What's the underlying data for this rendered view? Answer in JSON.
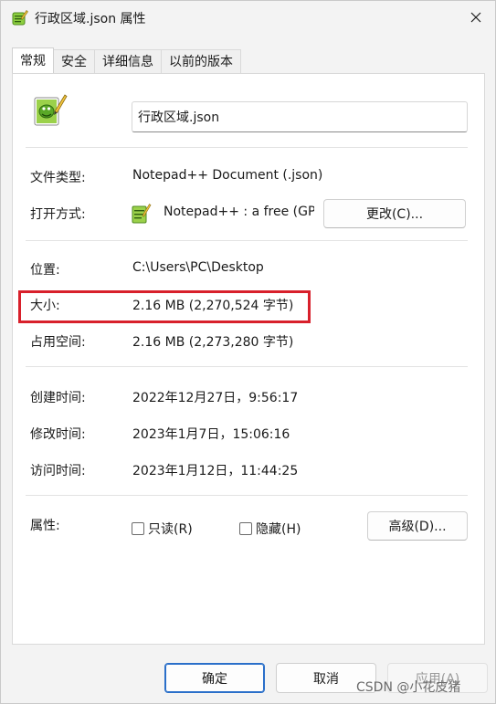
{
  "window": {
    "title": "行政区域.json 属性",
    "icon": "notepadpp-icon"
  },
  "tabs": [
    {
      "label": "常规",
      "active": true
    },
    {
      "label": "安全",
      "active": false
    },
    {
      "label": "详细信息",
      "active": false
    },
    {
      "label": "以前的版本",
      "active": false
    }
  ],
  "general": {
    "filename": "行政区域.json",
    "file_type_label": "文件类型:",
    "file_type_value": "Notepad++ Document (.json)",
    "open_with_label": "打开方式:",
    "open_with_value": "Notepad++ : a free (GPL) source code editor",
    "change_button": "更改(C)...",
    "location_label": "位置:",
    "location_value": "C:\\Users\\PC\\Desktop",
    "size_label": "大小:",
    "size_value": "2.16 MB (2,270,524 字节)",
    "size_on_disk_label": "占用空间:",
    "size_on_disk_value": "2.16 MB (2,273,280 字节)",
    "created_label": "创建时间:",
    "created_value": "2022年12月27日，9:56:17",
    "modified_label": "修改时间:",
    "modified_value": "2023年1月7日，15:06:16",
    "accessed_label": "访问时间:",
    "accessed_value": "2023年1月12日，11:44:25",
    "attributes_label": "属性:",
    "readonly_label": "只读(R)",
    "readonly_checked": false,
    "hidden_label": "隐藏(H)",
    "hidden_checked": false,
    "advanced_button": "高级(D)..."
  },
  "footer": {
    "ok": "确定",
    "cancel": "取消",
    "apply": "应用(A)"
  },
  "watermark": "CSDN @小花皮猪",
  "colors": {
    "highlight_box": "#d8202b",
    "primary_border": "#2a6fc9"
  }
}
